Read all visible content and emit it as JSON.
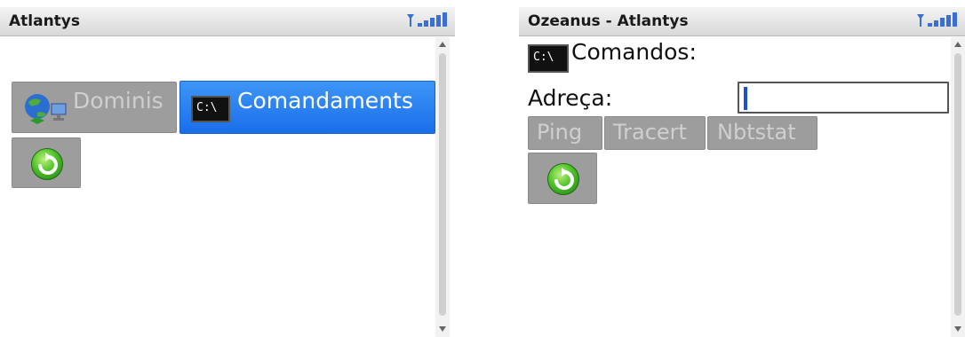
{
  "left": {
    "title": "Atlantys",
    "buttons": {
      "domains": "Dominis",
      "commands": "Comandaments"
    },
    "command_icon_text": "C:\\"
  },
  "right": {
    "title": "Ozeanus - Atlantys",
    "commands_label": "Comandos:",
    "command_icon_text": "C:\\",
    "address_label": "Adreça:",
    "address_value": "",
    "tools": [
      "Ping",
      "Tracert",
      "Nbtstat"
    ]
  },
  "colors": {
    "selected_button": "#1a6fe9",
    "button_gray": "#9d9d9d",
    "caret_blue": "#1a4fd8",
    "go_green": "#4fc12a"
  },
  "icons": {
    "signal": "signal-strength-icon",
    "domains": "globe-network-icon",
    "command": "command-prompt-icon",
    "go": "green-go-refresh-icon"
  }
}
